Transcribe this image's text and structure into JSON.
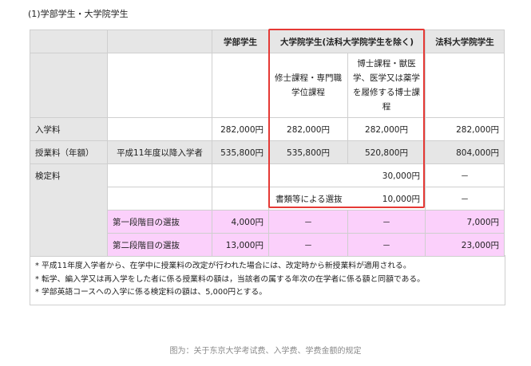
{
  "heading": "(1)学部学生・大学院学生",
  "header": {
    "undergrad": "学部学生",
    "grad": "大学院学生(法科大学院学生を除く)",
    "law": "法科大学院学生"
  },
  "subheader": {
    "masters": "修士課程・専門職学位課程",
    "doctoral": "博士課程・獣医学、医学又は薬学を履修する博士課程"
  },
  "rows": {
    "admission": {
      "label": "入学料",
      "undergrad": "282,000円",
      "masters": "282,000円",
      "doctoral": "282,000円",
      "law": "282,000円"
    },
    "tuition": {
      "label": "授業料（年額）",
      "sub": "平成11年度以降入学者",
      "undergrad": "535,800円",
      "masters": "535,800円",
      "doctoral": "520,800円",
      "law": "804,000円"
    },
    "exam": {
      "label": "検定料",
      "grad_amount": "30,000円",
      "law": "－",
      "doc_label": "書類等による選抜",
      "doc_amount": "10,000円",
      "law2": "－"
    },
    "stage1": {
      "label": "第一段階目の選抜",
      "undergrad": "4,000円",
      "masters": "－",
      "doctoral": "－",
      "law": "7,000円"
    },
    "stage2": {
      "label": "第二段階目の選抜",
      "undergrad": "13,000円",
      "masters": "－",
      "doctoral": "－",
      "law": "23,000円"
    }
  },
  "notes": [
    "* 平成11年度入学者から、在学中に授業料の改定が行われた場合には、改定時から新授業料が適用される。",
    "* 転学、編入学又は再入学をした者に係る授業料の額は，当該者の属する年次の在学者に係る額と同額である。",
    "* 学部英語コースへの入学に係る検定料の額は、5,000円とする。"
  ],
  "caption": "图为：关于东京大学考试费、入学费、学费金额的规定",
  "colors": {
    "highlight_border": "#e53935",
    "pink_row": "#fbd0fb",
    "gray_cell": "#e6e6e6"
  }
}
